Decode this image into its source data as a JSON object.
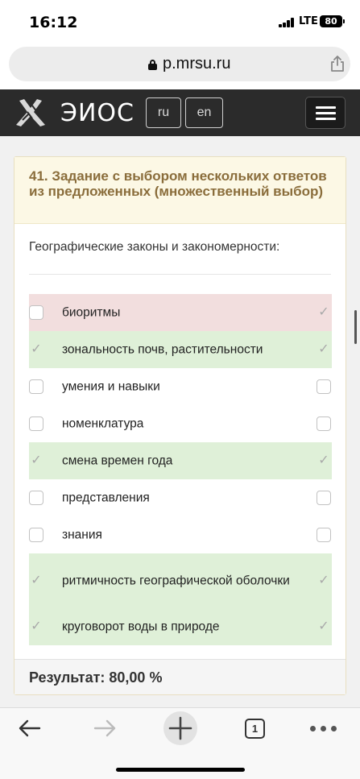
{
  "status_bar": {
    "time": "16:12",
    "network": "LTE",
    "battery": "80"
  },
  "browser": {
    "url": "p.mrsu.ru"
  },
  "site_header": {
    "logo_text": "ЭИОС",
    "lang_ru": "ru",
    "lang_en": "en"
  },
  "question": {
    "title": "41. Задание с выбором нескольких ответов из предложенных (множественный выбор)",
    "text": "Географические законы и  закономерности:",
    "answers": [
      {
        "label": "биоритмы",
        "state": "wrong",
        "selected": false,
        "correct": true
      },
      {
        "label": "зональность почв, растительности",
        "state": "right",
        "selected": true,
        "correct": true
      },
      {
        "label": "умения и навыки",
        "state": "none",
        "selected": false,
        "correct": false
      },
      {
        "label": "номенклатура",
        "state": "none",
        "selected": false,
        "correct": false
      },
      {
        "label": "смена времен года",
        "state": "right",
        "selected": true,
        "correct": true
      },
      {
        "label": "представления",
        "state": "none",
        "selected": false,
        "correct": false
      },
      {
        "label": "знания",
        "state": "none",
        "selected": false,
        "correct": false
      },
      {
        "label": "ритмичность географической оболочки",
        "state": "right",
        "selected": true,
        "correct": true
      },
      {
        "label": "круговорот воды в природе",
        "state": "right",
        "selected": true,
        "correct": true
      }
    ],
    "result": "Результат: 80,00 %"
  },
  "toolbar": {
    "tab_count": "1"
  },
  "colors": {
    "header_bg": "#2b2b2b",
    "wrong_bg": "#f2dede",
    "right_bg": "#dff0d8",
    "title_color": "#8a6d3b"
  }
}
